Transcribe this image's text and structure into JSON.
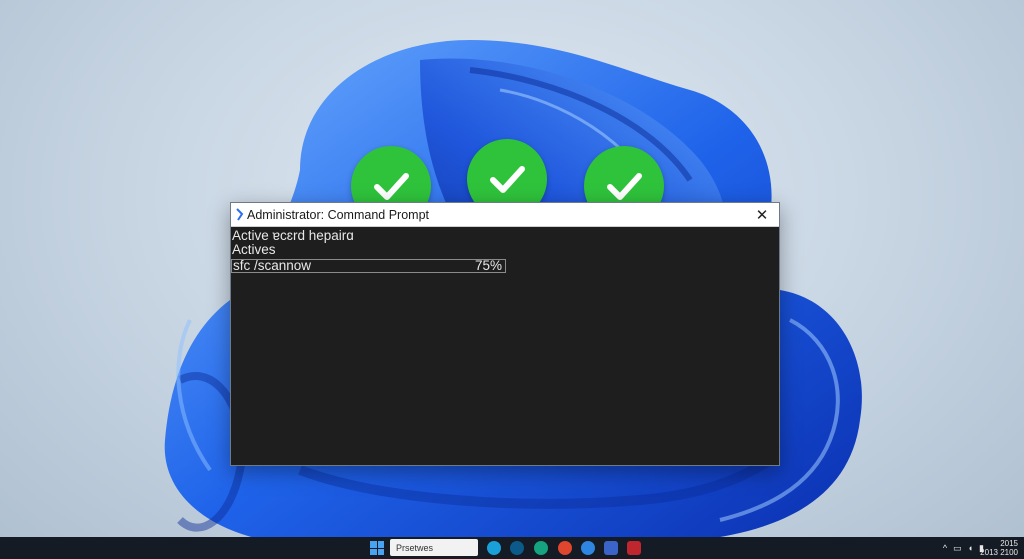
{
  "window": {
    "title": "Administrator: Command Prompt",
    "close_glyph": "✕"
  },
  "console": {
    "lines": [
      "Active ɐcɛrd hepairɑ",
      "Actives"
    ],
    "command": "sfc /scannow",
    "progress_text": "75%",
    "progress": 75
  },
  "checks": [
    {
      "icon": "checkmark-icon",
      "color": "#2fc33c"
    },
    {
      "icon": "checkmark-icon",
      "color": "#2fc33c"
    },
    {
      "icon": "checkmark-icon",
      "color": "#2fc33c"
    }
  ],
  "taskbar": {
    "search_placeholder": "Prsetwes",
    "tray_chevron": "^",
    "clock_line1": "2015",
    "clock_line2": "2013 2100"
  },
  "colors": {
    "accent": "#2a6ff0",
    "check_green": "#2fc33c",
    "console_bg": "#1e1e1e",
    "taskbar_bg": "#141b24"
  }
}
